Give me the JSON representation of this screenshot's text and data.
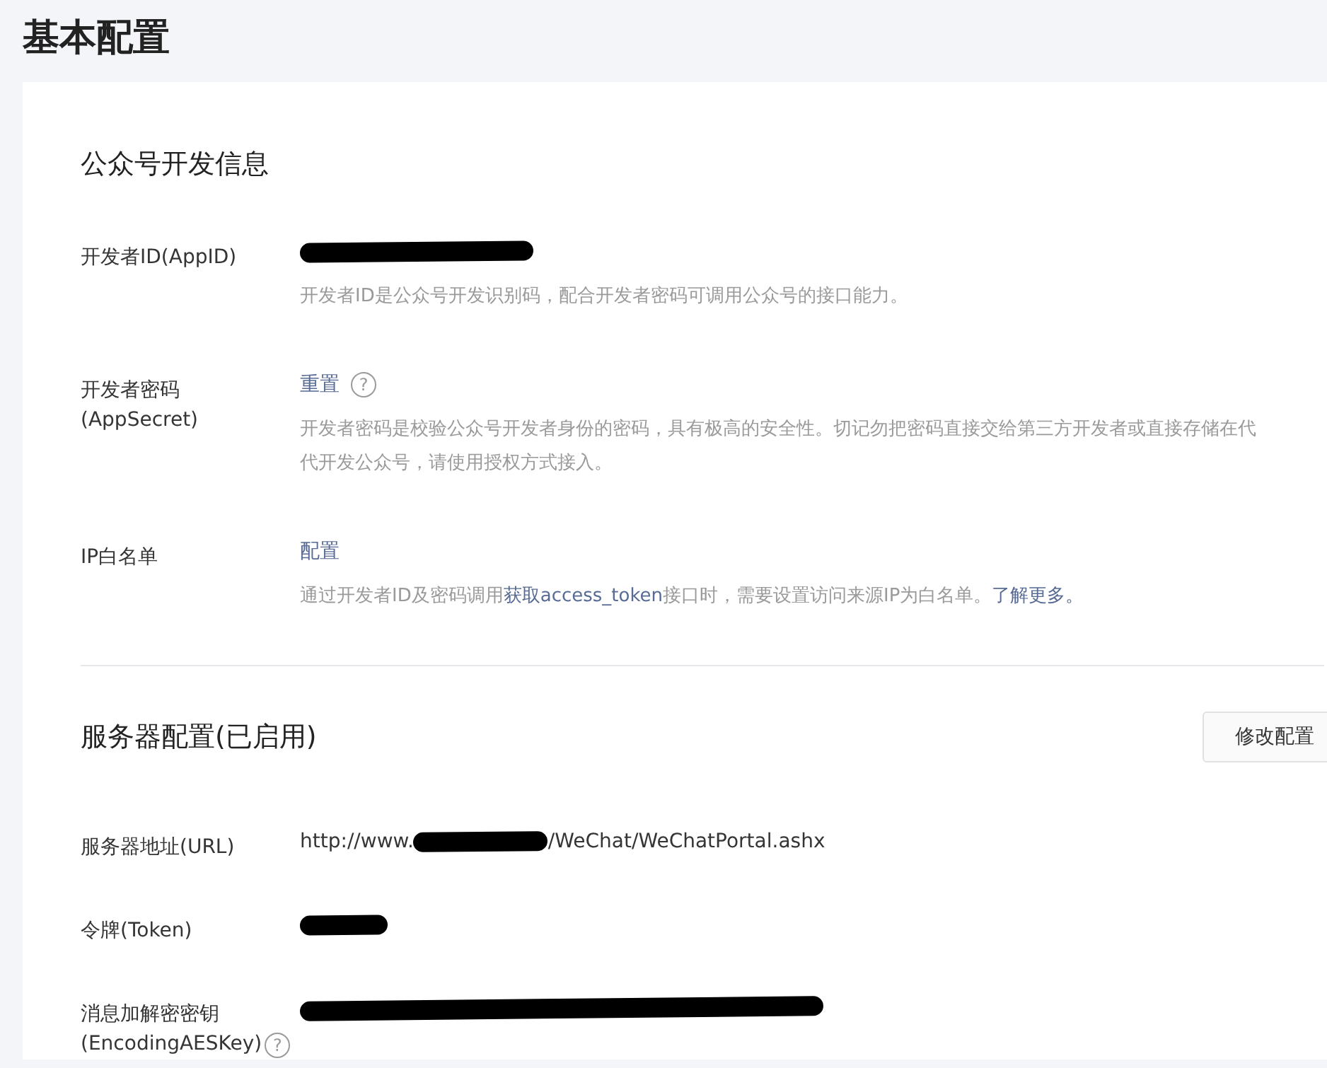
{
  "page_title": "基本配置",
  "sections": [
    {
      "title": "公众号开发信息",
      "rows": [
        {
          "label": [
            "开发者ID(AppID)"
          ],
          "label_help": null,
          "value": [
            {
              "kind": "redaction"
            }
          ],
          "value_help": null,
          "description": [
            [
              {
                "text": "开发者ID是公众号开发识别码，配合开发者密码可调用公众号的接口能力。",
                "link": false
              }
            ]
          ]
        },
        {
          "label": [
            "开发者密码",
            "(AppSecret)"
          ],
          "label_help": null,
          "value": [
            {
              "kind": "link",
              "text": "重置"
            }
          ],
          "value_help": "?",
          "description": [
            [
              {
                "text": "开发者密码是校验公众号开发者身份的密码，具有极高的安全性。切记勿把密码直接交给第三方开发者或直接存储在代",
                "link": false
              }
            ],
            [
              {
                "text": "代开发公众号，请使用授权方式接入。",
                "link": false
              }
            ]
          ]
        },
        {
          "label": [
            "IP白名单"
          ],
          "label_help": null,
          "value": [
            {
              "kind": "link",
              "text": "配置"
            }
          ],
          "value_help": null,
          "description": [
            [
              {
                "text": "通过开发者ID及密码调用",
                "link": false
              },
              {
                "text": "获取access_token",
                "link": true
              },
              {
                "text": "接口时，需要设置访问来源IP为白名单。",
                "link": false
              },
              {
                "text": "了解更多。",
                "link": true
              }
            ]
          ]
        }
      ]
    },
    {
      "title": "服务器配置(已启用)",
      "action": "修改配置",
      "rows": [
        {
          "label": [
            "服务器地址(URL)"
          ],
          "label_help": null,
          "value": [
            {
              "kind": "text",
              "text": "http://www."
            },
            {
              "kind": "redaction"
            },
            {
              "kind": "text",
              "text": "/WeChat/WeChatPortal.ashx"
            }
          ],
          "value_help": null,
          "description": []
        },
        {
          "label": [
            "令牌(Token)"
          ],
          "label_help": null,
          "value": [
            {
              "kind": "redaction"
            }
          ],
          "value_help": null,
          "description": []
        },
        {
          "label": [
            "消息加解密密钥",
            "(EncodingAESKey)"
          ],
          "label_help": "?",
          "value": [
            {
              "kind": "redaction"
            }
          ],
          "value_help": null,
          "description": []
        }
      ]
    }
  ]
}
